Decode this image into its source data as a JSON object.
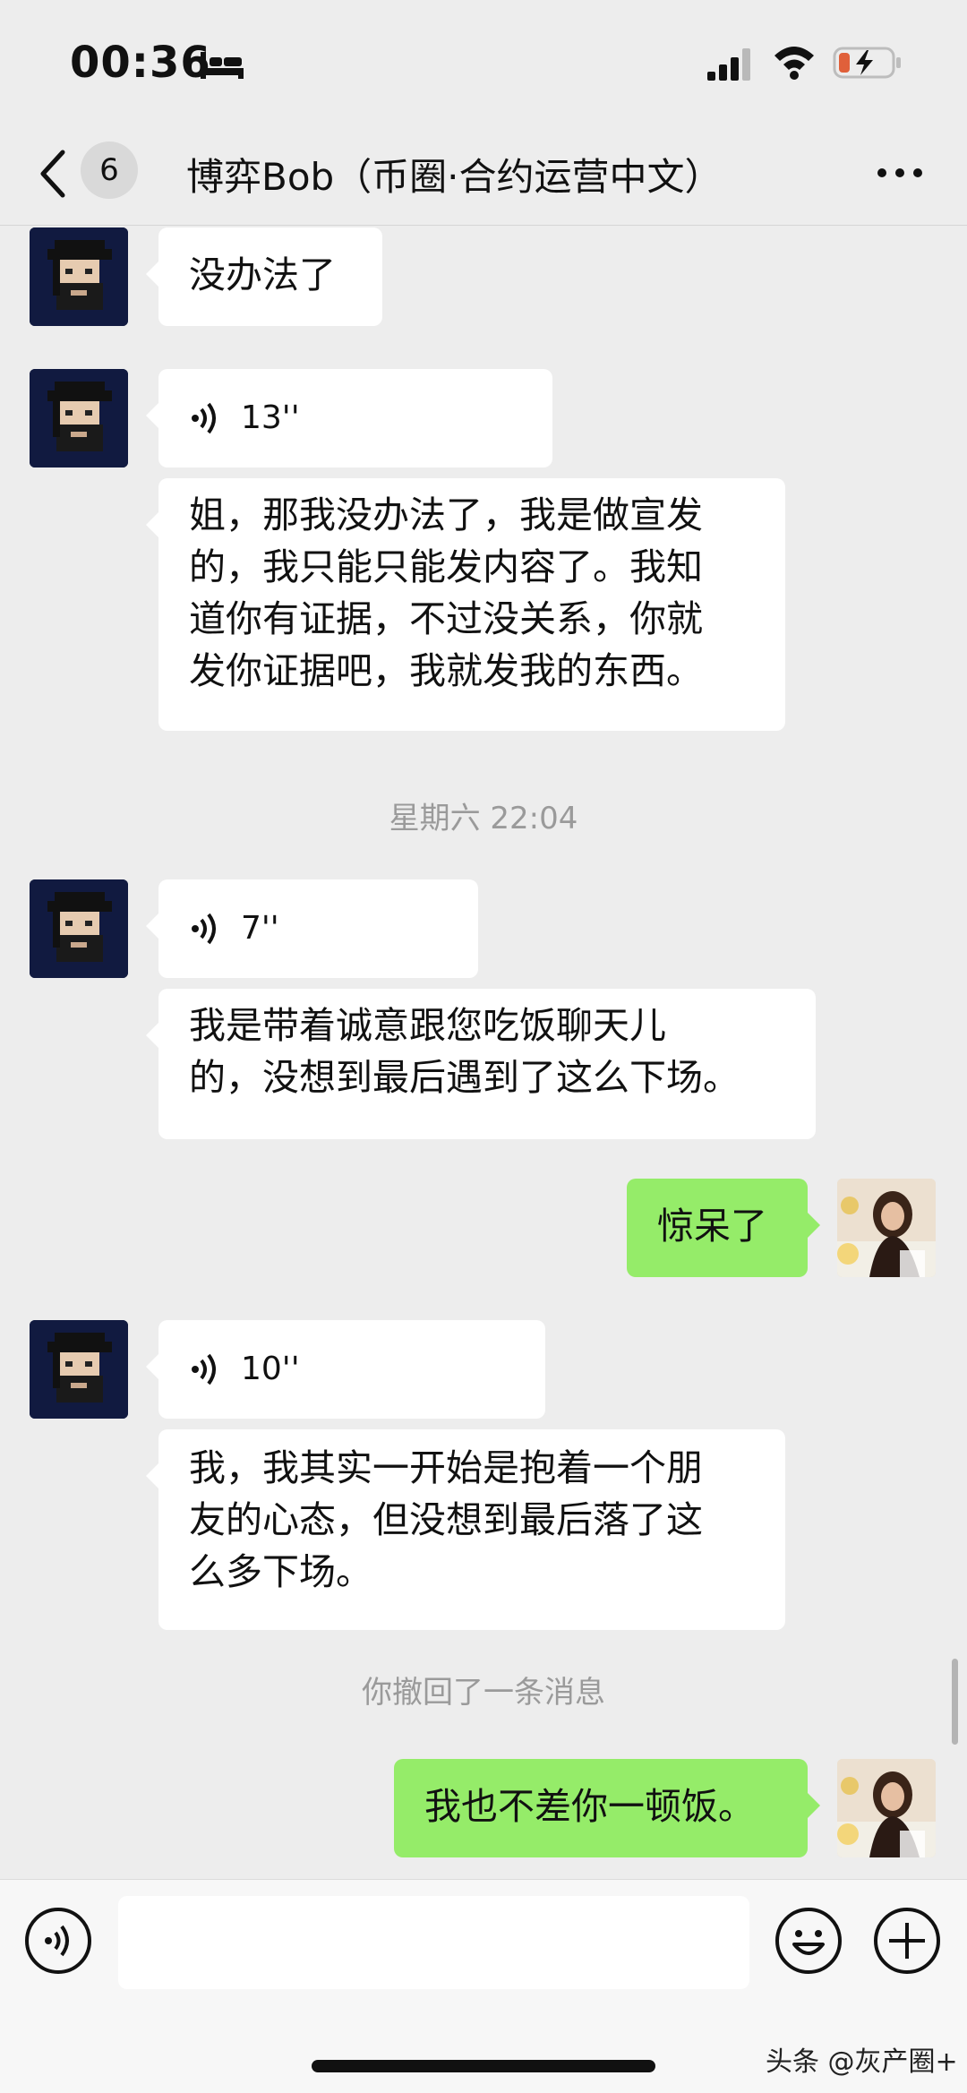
{
  "status_bar": {
    "time": "00:36"
  },
  "nav": {
    "unread_count": "6",
    "title": "博弈Bob（币圈·合约运营中文）"
  },
  "messages": {
    "m1": {
      "text": "没办法了"
    },
    "m2": {
      "duration": "13''"
    },
    "m3": {
      "lines": [
        "姐，那我没办法了，我是做宣发",
        "的，我只能只能发内容了。我知",
        "道你有证据，不过没关系，你就",
        "发你证据吧，我就发我的东西。"
      ]
    },
    "timestamp": "星期六 22:04",
    "m4": {
      "duration": "7''"
    },
    "m5": {
      "lines": [
        "我是带着诚意跟您吃饭聊天儿",
        "的，没想到最后遇到了这么下场。"
      ]
    },
    "m6": {
      "text": "惊呆了"
    },
    "m7": {
      "duration": "10''"
    },
    "m8": {
      "lines": [
        "我，我其实一开始是抱着一个朋",
        "友的心态，但没想到最后落了这",
        "么多下场。"
      ]
    },
    "recall_notice": "你撤回了一条消息",
    "m9": {
      "text": "我也不差你一顿饭。"
    }
  },
  "watermark": "头条 @灰产圈+",
  "colors": {
    "background": "#ededed",
    "my_bubble": "#95ec69",
    "their_bubble": "#ffffff",
    "input_bar": "#f7f7f7"
  },
  "icons": {
    "back": "chevron-left-icon",
    "more": "ellipsis-icon",
    "voice_mode": "voice-mode-icon",
    "emoji": "emoji-icon",
    "plus": "plus-circle-icon"
  }
}
